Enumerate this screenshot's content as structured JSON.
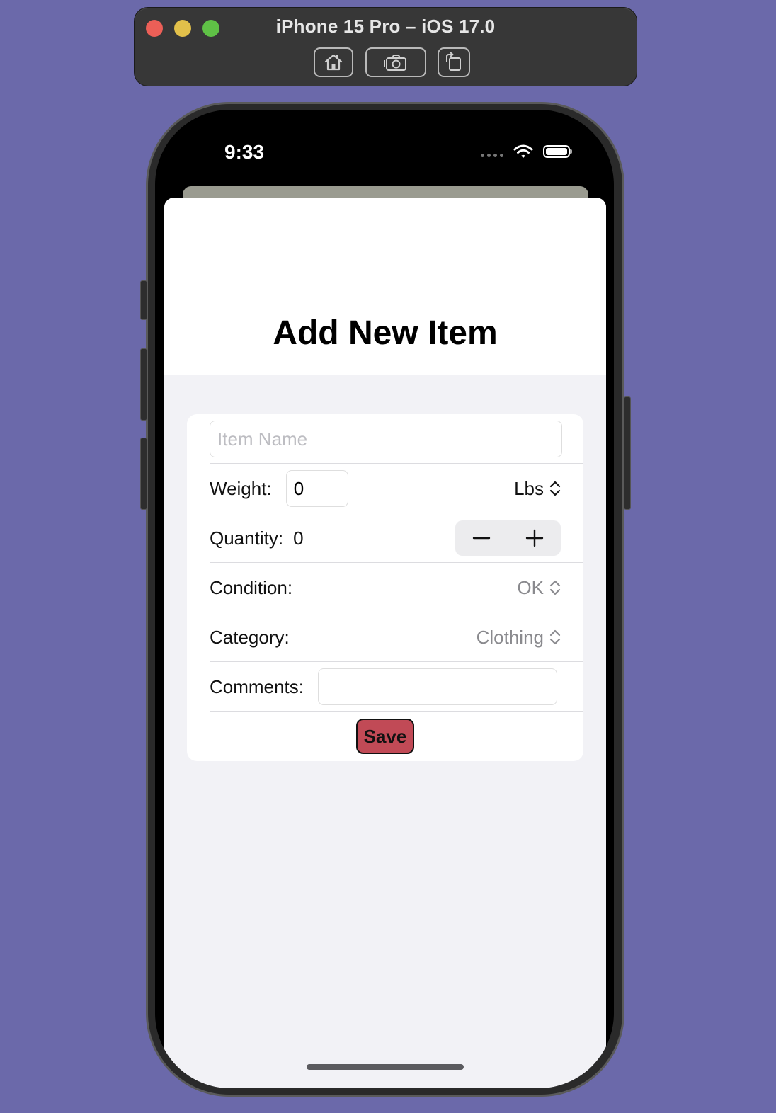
{
  "simulator": {
    "title": "iPhone 15 Pro – iOS 17.0",
    "toolbar_icons": [
      "home-icon",
      "camera-icon",
      "rotate-icon"
    ]
  },
  "status_bar": {
    "time": "9:33",
    "icons": [
      "signal-dots-icon",
      "wifi-icon",
      "battery-icon"
    ]
  },
  "sheet": {
    "title": "Add New Item"
  },
  "form": {
    "item_name": {
      "value": "",
      "placeholder": "Item Name"
    },
    "weight": {
      "label": "Weight:",
      "value": "0",
      "unit": "Lbs"
    },
    "quantity": {
      "label": "Quantity:",
      "value": "0",
      "decrement_icon": "minus-icon",
      "increment_icon": "plus-icon"
    },
    "condition": {
      "label": "Condition:",
      "value": "OK"
    },
    "category": {
      "label": "Category:",
      "value": "Clothing"
    },
    "comments": {
      "label": "Comments:",
      "value": ""
    },
    "save_label": "Save"
  },
  "colors": {
    "desktop_background": "#6b69aa",
    "save_button": "#c14a56",
    "sheet_background": "#f2f2f6"
  }
}
